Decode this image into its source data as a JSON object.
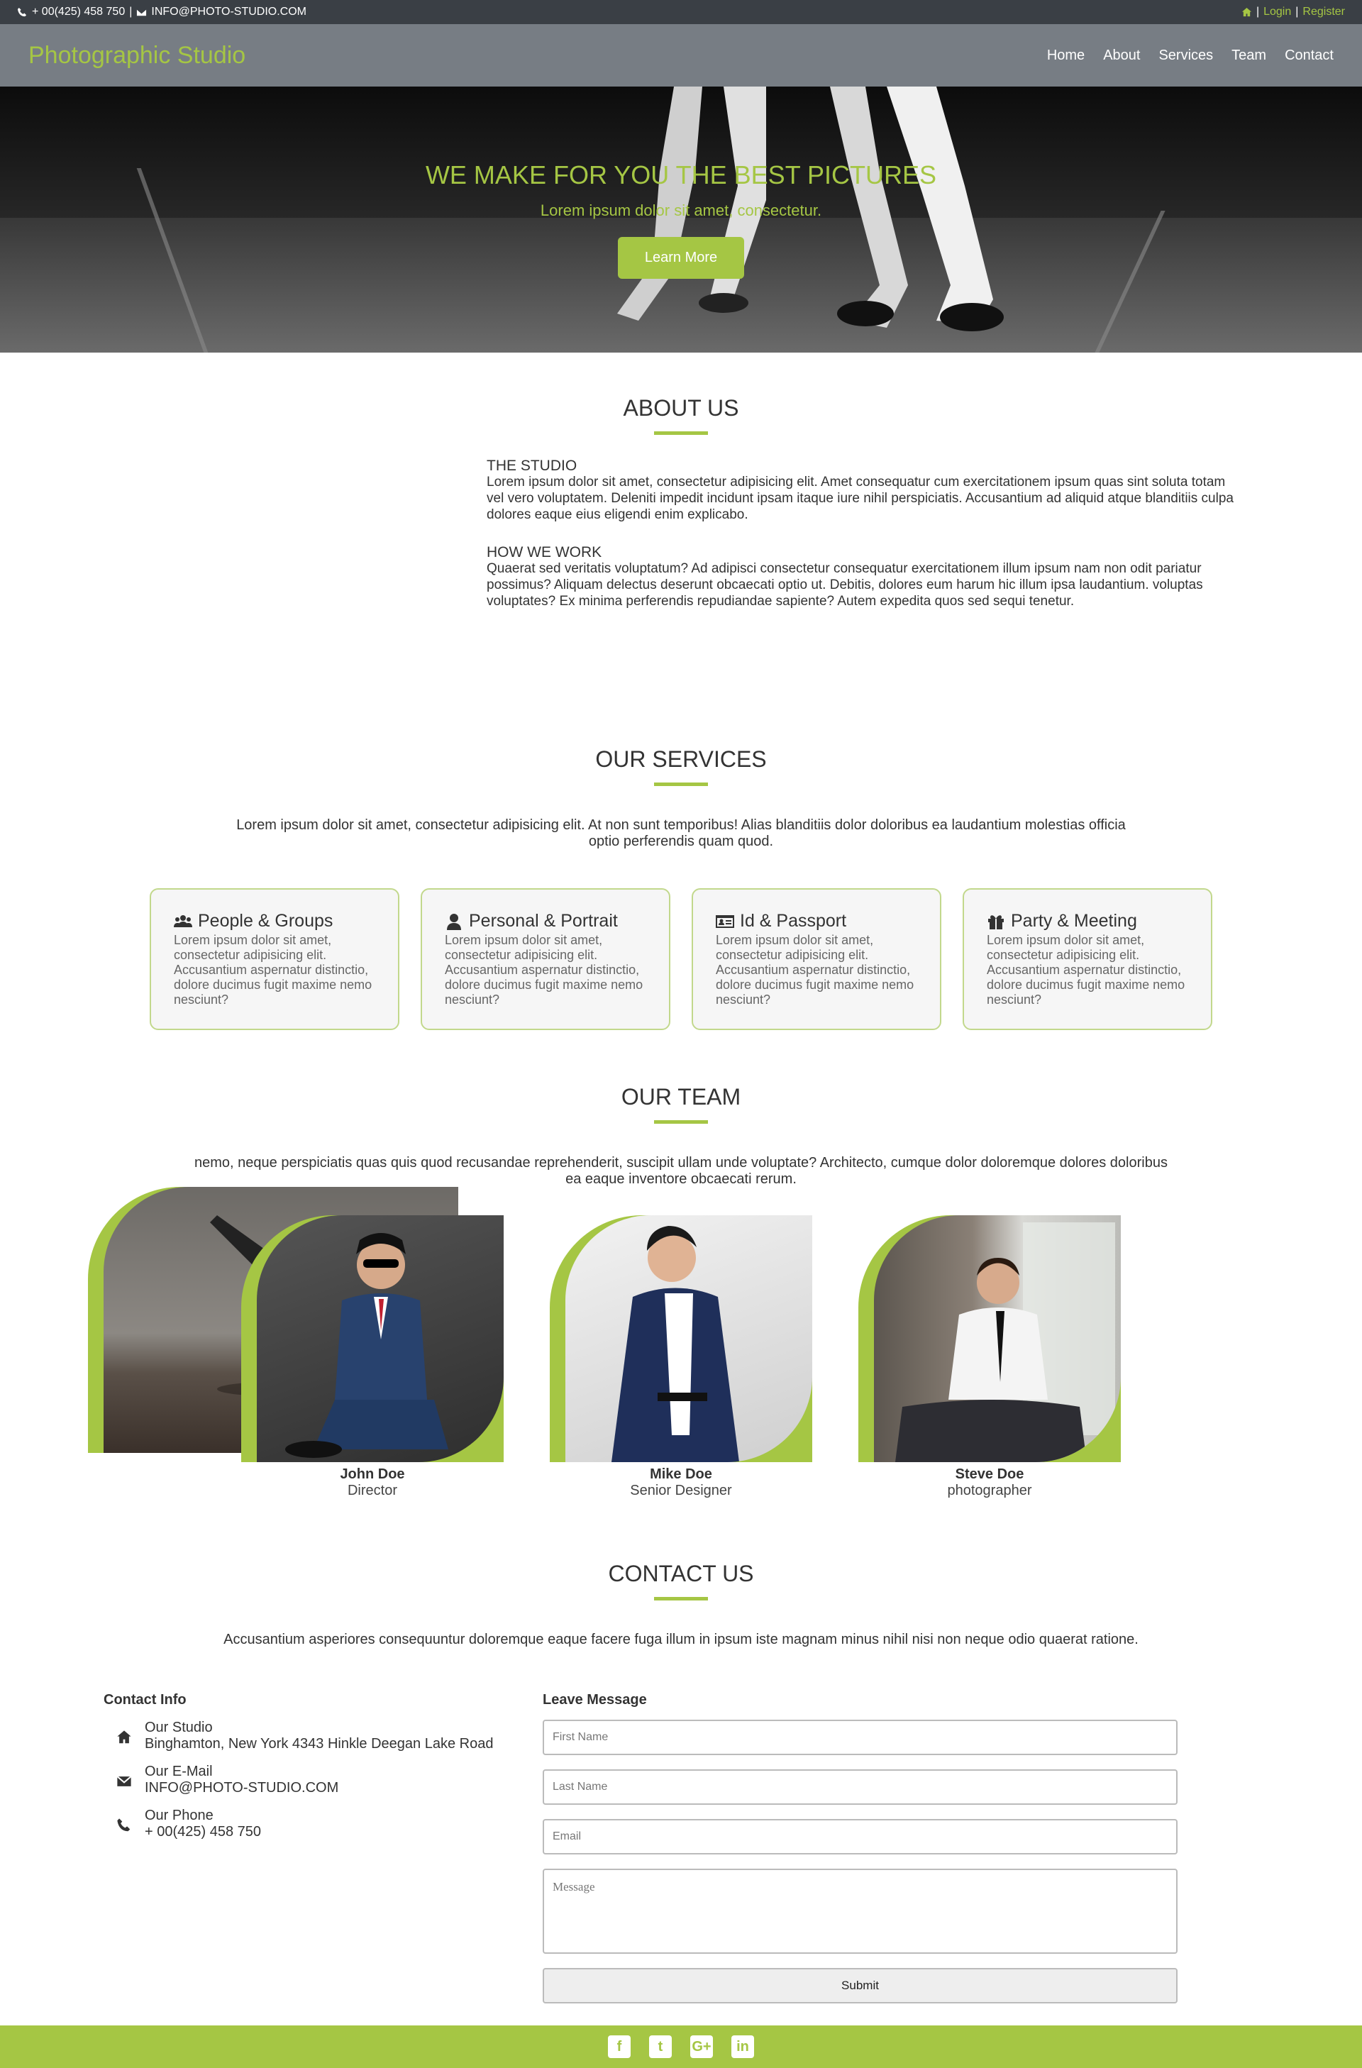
{
  "topbar": {
    "phone": "+ 00(425) 458 750",
    "separator": "|",
    "email": "INFO@PHOTO-STUDIO.COM",
    "login": "Login",
    "register": "Register"
  },
  "nav": {
    "brand": "Photographic Studio",
    "items": [
      "Home",
      "About",
      "Services",
      "Team",
      "Contact"
    ]
  },
  "hero": {
    "title": "WE MAKE FOR YOU THE BEST PICTURES",
    "subtitle": "Lorem ipsum dolor sit amet, consectetur.",
    "button": "Learn More"
  },
  "about": {
    "title": "ABOUT US",
    "blocks": [
      {
        "heading": "THE STUDIO",
        "text": "Lorem ipsum dolor sit amet, consectetur adipisicing elit. Amet consequatur cum exercitationem ipsum quas sint soluta totam vel vero voluptatem. Deleniti impedit incidunt ipsam itaque iure nihil perspiciatis. Accusantium ad aliquid atque blanditiis culpa dolores eaque eius eligendi enim explicabo."
      },
      {
        "heading": "HOW WE WORK",
        "text": "Quaerat sed veritatis voluptatum? Ad adipisci consectetur consequatur exercitationem illum ipsum nam non odit pariatur possimus? Aliquam delectus deserunt obcaecati optio ut. Debitis, dolores eum harum hic illum ipsa laudantium. voluptas voluptates? Ex minima perferendis repudiandae sapiente? Autem expedita quos sed sequi tenetur."
      }
    ]
  },
  "services": {
    "title": "OUR SERVICES",
    "description": "Lorem ipsum dolor sit amet, consectetur adipisicing elit. At non sunt temporibus! Alias blanditiis dolor doloribus ea laudantium molestias officia optio perferendis quam quod.",
    "cards": [
      {
        "icon": "users-icon",
        "title": "People & Groups",
        "text": "Lorem ipsum dolor sit amet, consectetur adipisicing elit. Accusantium aspernatur distinctio, dolore ducimus fugit maxime nemo nesciunt?"
      },
      {
        "icon": "user-icon",
        "title": "Personal & Portrait",
        "text": "Lorem ipsum dolor sit amet, consectetur adipisicing elit. Accusantium aspernatur distinctio, dolore ducimus fugit maxime nemo nesciunt?"
      },
      {
        "icon": "id-card-icon",
        "title": "Id & Passport",
        "text": "Lorem ipsum dolor sit amet, consectetur adipisicing elit. Accusantium aspernatur distinctio, dolore ducimus fugit maxime nemo nesciunt?"
      },
      {
        "icon": "gift-icon",
        "title": "Party & Meeting",
        "text": "Lorem ipsum dolor sit amet, consectetur adipisicing elit. Accusantium aspernatur distinctio, dolore ducimus fugit maxime nemo nesciunt?"
      }
    ]
  },
  "team": {
    "title": "OUR TEAM",
    "description": "nemo, neque perspiciatis quas quis quod recusandae reprehenderit, suscipit ullam unde voluptate? Architecto, cumque dolor doloremque dolores doloribus ea eaque inventore obcaecati rerum.",
    "members": [
      {
        "name": "John Doe",
        "role": "Director"
      },
      {
        "name": "Mike Doe",
        "role": "Senior Designer"
      },
      {
        "name": "Steve Doe",
        "role": "photographer"
      }
    ]
  },
  "contact": {
    "title": "CONTACT US",
    "description": "Accusantium asperiores consequuntur doloremque eaque facere fuga illum in ipsum iste magnam minus nihil nisi non neque odio quaerat ratione.",
    "info_heading": "Contact Info",
    "items": [
      {
        "icon": "home-icon",
        "label": "Our Studio",
        "value": "Binghamton, New York 4343 Hinkle Deegan Lake Road"
      },
      {
        "icon": "envelope-icon",
        "label": "Our E-Mail",
        "value": "INFO@PHOTO-STUDIO.COM"
      },
      {
        "icon": "phone-icon",
        "label": "Our Phone",
        "value": "+ 00(425) 458 750"
      }
    ],
    "form_heading": "Leave Message",
    "fields": {
      "first_name": "First Name",
      "last_name": "Last Name",
      "email": "Email",
      "message": "Message"
    },
    "submit": "Submit"
  },
  "footer": {
    "social": [
      "facebook-icon",
      "twitter-icon",
      "google-plus-icon",
      "linkedin-icon"
    ]
  },
  "colors": {
    "accent": "#a5c644",
    "topbar": "#3a3f45",
    "navbar": "#777d84"
  }
}
